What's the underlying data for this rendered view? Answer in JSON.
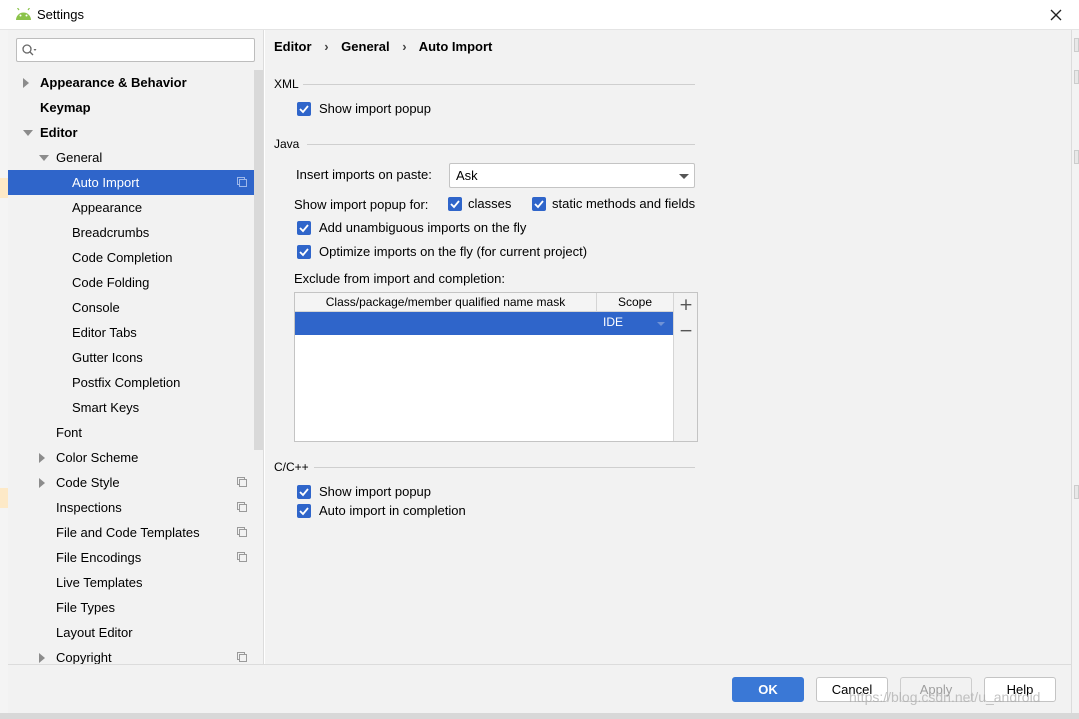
{
  "window": {
    "title": "Settings"
  },
  "search": {
    "placeholder": ""
  },
  "sidebar": {
    "items": [
      {
        "label": "Appearance & Behavior",
        "bold": true,
        "level": 0,
        "arrow": "right",
        "proj": false,
        "selected": false
      },
      {
        "label": "Keymap",
        "bold": true,
        "level": 0,
        "arrow": "",
        "proj": false,
        "selected": false
      },
      {
        "label": "Editor",
        "bold": true,
        "level": 0,
        "arrow": "down",
        "proj": false,
        "selected": false
      },
      {
        "label": "General",
        "bold": false,
        "level": 1,
        "arrow": "down",
        "proj": false,
        "selected": false
      },
      {
        "label": "Auto Import",
        "bold": false,
        "level": 2,
        "arrow": "",
        "proj": true,
        "selected": true
      },
      {
        "label": "Appearance",
        "bold": false,
        "level": 2,
        "arrow": "",
        "proj": false,
        "selected": false
      },
      {
        "label": "Breadcrumbs",
        "bold": false,
        "level": 2,
        "arrow": "",
        "proj": false,
        "selected": false
      },
      {
        "label": "Code Completion",
        "bold": false,
        "level": 2,
        "arrow": "",
        "proj": false,
        "selected": false
      },
      {
        "label": "Code Folding",
        "bold": false,
        "level": 2,
        "arrow": "",
        "proj": false,
        "selected": false
      },
      {
        "label": "Console",
        "bold": false,
        "level": 2,
        "arrow": "",
        "proj": false,
        "selected": false
      },
      {
        "label": "Editor Tabs",
        "bold": false,
        "level": 2,
        "arrow": "",
        "proj": false,
        "selected": false
      },
      {
        "label": "Gutter Icons",
        "bold": false,
        "level": 2,
        "arrow": "",
        "proj": false,
        "selected": false
      },
      {
        "label": "Postfix Completion",
        "bold": false,
        "level": 2,
        "arrow": "",
        "proj": false,
        "selected": false
      },
      {
        "label": "Smart Keys",
        "bold": false,
        "level": 2,
        "arrow": "",
        "proj": false,
        "selected": false
      },
      {
        "label": "Font",
        "bold": false,
        "level": 1,
        "arrow": "",
        "proj": false,
        "selected": false
      },
      {
        "label": "Color Scheme",
        "bold": false,
        "level": 1,
        "arrow": "right",
        "proj": false,
        "selected": false
      },
      {
        "label": "Code Style",
        "bold": false,
        "level": 1,
        "arrow": "right",
        "proj": true,
        "selected": false
      },
      {
        "label": "Inspections",
        "bold": false,
        "level": 1,
        "arrow": "",
        "proj": true,
        "selected": false
      },
      {
        "label": "File and Code Templates",
        "bold": false,
        "level": 1,
        "arrow": "",
        "proj": true,
        "selected": false
      },
      {
        "label": "File Encodings",
        "bold": false,
        "level": 1,
        "arrow": "",
        "proj": true,
        "selected": false
      },
      {
        "label": "Live Templates",
        "bold": false,
        "level": 1,
        "arrow": "",
        "proj": false,
        "selected": false
      },
      {
        "label": "File Types",
        "bold": false,
        "level": 1,
        "arrow": "",
        "proj": false,
        "selected": false
      },
      {
        "label": "Layout Editor",
        "bold": false,
        "level": 1,
        "arrow": "",
        "proj": false,
        "selected": false
      },
      {
        "label": "Copyright",
        "bold": false,
        "level": 1,
        "arrow": "right",
        "proj": true,
        "selected": false
      }
    ]
  },
  "breadcrumb": [
    "Editor",
    "General",
    "Auto Import"
  ],
  "breadcrumb_sep": "›",
  "xml": {
    "section": "XML",
    "show_popup": "Show import popup"
  },
  "java": {
    "section": "Java",
    "insert_label": "Insert imports on paste:",
    "insert_value": "Ask",
    "popup_for_label": "Show import popup for:",
    "classes": "classes",
    "static": "static methods and fields",
    "unambiguous": "Add unambiguous imports on the fly",
    "optimize": "Optimize imports on the fly (for current project)",
    "exclude_label": "Exclude from import and completion:",
    "table": {
      "col_mask": "Class/package/member qualified name mask",
      "col_scope": "Scope",
      "row_scope": "IDE",
      "add": "+",
      "remove": "−"
    }
  },
  "cpp": {
    "section": "C/C++",
    "show_popup": "Show import popup",
    "auto_import": "Auto import in completion"
  },
  "footer": {
    "ok": "OK",
    "cancel": "Cancel",
    "apply": "Apply",
    "help": "Help"
  },
  "watermark": "https://blog.csdn.net/u_android",
  "colors": {
    "accent": "#2f65ca",
    "ok_button": "#3a78d6",
    "panel": "#f2f2f2"
  }
}
